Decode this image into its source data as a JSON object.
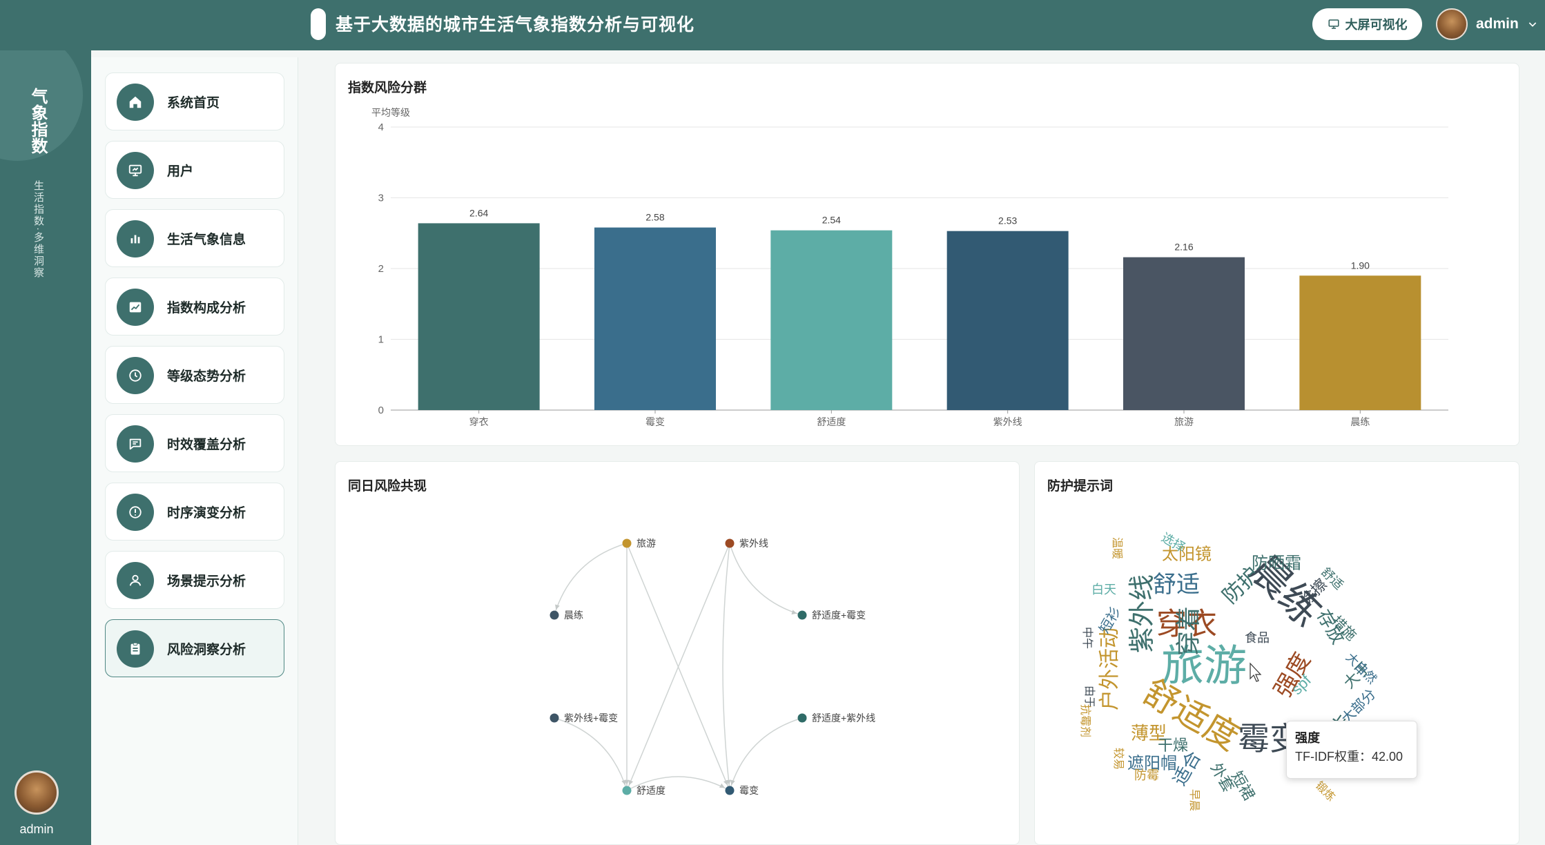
{
  "header": {
    "title": "基于大数据的城市生活气象指数分析与可视化",
    "bigscreen_label": "大屏可视化",
    "user_name": "admin"
  },
  "rail": {
    "logo_text": "气象指数",
    "slogan": "生活指数·多维洞察",
    "user_name": "admin"
  },
  "menu": {
    "items": [
      {
        "label": "系统首页",
        "icon": "home-icon"
      },
      {
        "label": "用户",
        "icon": "monitor-icon"
      },
      {
        "label": "生活气象信息",
        "icon": "bar-chart-icon"
      },
      {
        "label": "指数构成分析",
        "icon": "line-chart-icon"
      },
      {
        "label": "等级态势分析",
        "icon": "clock-icon"
      },
      {
        "label": "时效覆盖分析",
        "icon": "message-icon"
      },
      {
        "label": "时序演变分析",
        "icon": "alert-circle-icon"
      },
      {
        "label": "场景提示分析",
        "icon": "user-icon"
      },
      {
        "label": "风险洞察分析",
        "icon": "clipboard-icon"
      }
    ],
    "active_index": 8
  },
  "cards": {
    "bar_title": "指数风险分群",
    "graph_title": "同日风险共现",
    "cloud_title": "防护提示词"
  },
  "chart_data": [
    {
      "type": "bar",
      "title": "指数风险分群",
      "ylabel": "平均等级",
      "categories": [
        "穿衣",
        "霉变",
        "舒适度",
        "紫外线",
        "旅游",
        "晨练"
      ],
      "values": [
        2.64,
        2.58,
        2.54,
        2.53,
        2.16,
        1.9
      ],
      "value_labels": [
        "2.64",
        "2.58",
        "2.54",
        "2.53",
        "2.16",
        "1.90"
      ],
      "colors": [
        "#3e706d",
        "#3a6e8c",
        "#5dada6",
        "#325a73",
        "#4a5563",
        "#b89030"
      ],
      "ylim": [
        0,
        4
      ],
      "yticks": [
        "0",
        "1",
        "2",
        "3",
        "4"
      ],
      "grid": true
    },
    {
      "type": "graph",
      "title": "同日风险共现",
      "nodes": [
        {
          "name": "旅游",
          "color": "#c3952e"
        },
        {
          "name": "紫外线",
          "color": "#9c4a23"
        },
        {
          "name": "晨练",
          "color": "#3e5566"
        },
        {
          "name": "舒适度+霉变",
          "color": "#2f6b67"
        },
        {
          "name": "紫外线+霉变",
          "color": "#3e5566"
        },
        {
          "name": "舒适度+紫外线",
          "color": "#2f6b67"
        },
        {
          "name": "舒适度",
          "color": "#5dada6"
        },
        {
          "name": "霉变",
          "color": "#325a73"
        }
      ],
      "edges": [
        [
          "旅游",
          "晨练"
        ],
        [
          "旅游",
          "舒适度"
        ],
        [
          "旅游",
          "霉变"
        ],
        [
          "紫外线",
          "舒适度+霉变"
        ],
        [
          "紫外线",
          "舒适度"
        ],
        [
          "紫外线",
          "霉变"
        ],
        [
          "紫外线+霉变",
          "舒适度"
        ],
        [
          "舒适度+紫外线",
          "霉变"
        ],
        [
          "舒适度",
          "霉变"
        ]
      ]
    },
    {
      "type": "wordcloud",
      "title": "防护提示词",
      "words": [
        {
          "text": "旅游",
          "size": 62,
          "color": "#5dada6"
        },
        {
          "text": "晨练",
          "size": 58,
          "color": "#3e4a55"
        },
        {
          "text": "舒适度",
          "size": 50,
          "color": "#c3952e"
        },
        {
          "text": "穿衣",
          "size": 44,
          "color": "#9c4a23"
        },
        {
          "text": "霉变",
          "size": 46,
          "color": "#3e4a55"
        },
        {
          "text": "紫外线",
          "size": 38,
          "color": "#3e706d"
        },
        {
          "text": "穿着",
          "size": 36,
          "color": "#3e706d"
        },
        {
          "text": "舒适",
          "size": 34,
          "color": "#3a6e8c"
        },
        {
          "text": "户外活动",
          "size": 30,
          "color": "#c3952e"
        },
        {
          "text": "强度",
          "size": 34,
          "color": "#9c4a23"
        },
        {
          "text": "防护",
          "size": 30,
          "color": "#3e706d"
        },
        {
          "text": "太阳镜",
          "size": 24,
          "color": "#c3952e"
        },
        {
          "text": "防晒霜",
          "size": 24,
          "color": "#3e706d"
        },
        {
          "text": "薄型",
          "size": 26,
          "color": "#c3952e"
        },
        {
          "text": "遮阳帽",
          "size": 24,
          "color": "#3a6e8c"
        },
        {
          "text": "存放",
          "size": 26,
          "color": "#3e706d"
        },
        {
          "text": "适合",
          "size": 26,
          "color": "#3a6e8c"
        },
        {
          "text": "涂擦",
          "size": 22,
          "color": "#3e4a55"
        },
        {
          "text": "大于",
          "size": 22,
          "color": "#3e706d"
        },
        {
          "text": "措施",
          "size": 20,
          "color": "#3e706d"
        },
        {
          "text": "大自然",
          "size": 18,
          "color": "#3a6e8c"
        },
        {
          "text": "大部分",
          "size": 20,
          "color": "#3a6e8c"
        },
        {
          "text": "干燥",
          "size": 22,
          "color": "#3e706d"
        },
        {
          "text": "外套",
          "size": 22,
          "color": "#3e706d"
        },
        {
          "text": "短裙",
          "size": 22,
          "color": "#3e706d"
        },
        {
          "text": "防霉",
          "size": 18,
          "color": "#c3952e"
        },
        {
          "text": "食品",
          "size": 18,
          "color": "#3e4a55"
        },
        {
          "text": "spf",
          "size": 22,
          "color": "#5dada6"
        },
        {
          "text": "舒适",
          "size": 18,
          "color": "#3e706d"
        },
        {
          "text": "短衫",
          "size": 20,
          "color": "#3a6e8c"
        },
        {
          "text": "白天",
          "size": 18,
          "color": "#5dada6"
        },
        {
          "text": "温暖",
          "size": 16,
          "color": "#c3952e"
        },
        {
          "text": "选择",
          "size": 18,
          "color": "#5dada6"
        },
        {
          "text": "中午",
          "size": 16,
          "color": "#3e4a55"
        },
        {
          "text": "由于",
          "size": 16,
          "color": "#3e4a55"
        },
        {
          "text": "抗霉剂",
          "size": 16,
          "color": "#c3952e"
        },
        {
          "text": "较易",
          "size": 16,
          "color": "#c3952e"
        },
        {
          "text": "早晨",
          "size": 16,
          "color": "#c3952e"
        },
        {
          "text": "锻炼",
          "size": 16,
          "color": "#c3952e"
        },
        {
          "text": "发生",
          "size": 28,
          "color": "#3e706d"
        }
      ]
    }
  ],
  "tooltip": {
    "title": "强度",
    "value_text": "TF-IDF权重：42.00"
  }
}
